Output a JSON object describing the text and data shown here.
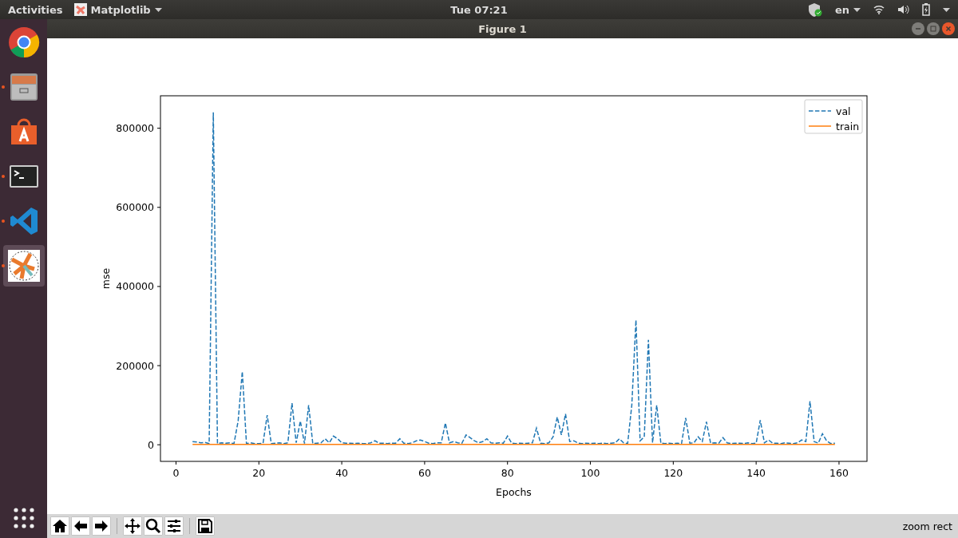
{
  "top_bar": {
    "activities": "Activities",
    "app_menu": "Matplotlib",
    "clock": "Tue 07:21",
    "language": "en"
  },
  "dock": {
    "items": [
      {
        "kind": "browser",
        "running": false,
        "selected": false
      },
      {
        "kind": "files",
        "running": true,
        "selected": false
      },
      {
        "kind": "software",
        "running": false,
        "selected": false
      },
      {
        "kind": "terminal",
        "running": true,
        "selected": false
      },
      {
        "kind": "editor",
        "running": true,
        "selected": false
      },
      {
        "kind": "matplotlib",
        "running": true,
        "selected": true
      }
    ]
  },
  "window": {
    "title": "Figure 1"
  },
  "figure": {
    "chart_data": {
      "type": "line",
      "xlabel": "Epochs",
      "ylabel": "mse",
      "x": [
        4,
        5,
        6,
        7,
        8,
        9,
        10,
        11,
        12,
        13,
        14,
        15,
        16,
        17,
        18,
        19,
        20,
        21,
        22,
        23,
        24,
        25,
        26,
        27,
        28,
        29,
        30,
        31,
        32,
        33,
        34,
        35,
        36,
        37,
        38,
        39,
        40,
        41,
        42,
        43,
        44,
        45,
        46,
        47,
        48,
        49,
        50,
        51,
        52,
        53,
        54,
        55,
        56,
        57,
        58,
        59,
        60,
        61,
        62,
        63,
        64,
        65,
        66,
        67,
        68,
        69,
        70,
        71,
        72,
        73,
        74,
        75,
        76,
        77,
        78,
        79,
        80,
        81,
        82,
        83,
        84,
        85,
        86,
        87,
        88,
        89,
        90,
        91,
        92,
        93,
        94,
        95,
        96,
        97,
        98,
        99,
        100,
        101,
        102,
        103,
        104,
        105,
        106,
        107,
        108,
        109,
        110,
        111,
        112,
        113,
        114,
        115,
        116,
        117,
        118,
        119,
        120,
        121,
        122,
        123,
        124,
        125,
        126,
        127,
        128,
        129,
        130,
        131,
        132,
        133,
        134,
        135,
        136,
        137,
        138,
        139,
        140,
        141,
        142,
        143,
        144,
        145,
        146,
        147,
        148,
        149,
        150,
        151,
        152,
        153,
        154,
        155,
        156,
        157,
        158,
        159
      ],
      "series": [
        {
          "name": "val",
          "color": "#1f77b4",
          "line_style": "dashed",
          "values": [
            8000,
            7000,
            5000,
            6000,
            3000,
            840000,
            3000,
            5000,
            4000,
            5000,
            3000,
            60000,
            185000,
            3000,
            5000,
            3000,
            3000,
            4000,
            75000,
            3000,
            4000,
            5000,
            3000,
            5000,
            105000,
            5000,
            60000,
            3000,
            100000,
            3000,
            4000,
            5000,
            15000,
            5000,
            22000,
            15000,
            5000,
            4000,
            4000,
            3000,
            4000,
            3000,
            3000,
            5000,
            10000,
            4000,
            4000,
            3000,
            4000,
            4000,
            15000,
            4000,
            3000,
            5000,
            10000,
            12000,
            8000,
            4000,
            3000,
            5000,
            5000,
            55000,
            5000,
            8000,
            5000,
            4000,
            25000,
            18000,
            10000,
            5000,
            8000,
            15000,
            5000,
            4000,
            5000,
            4000,
            22000,
            4000,
            3000,
            4000,
            3000,
            4000,
            5000,
            42000,
            4000,
            3000,
            5000,
            20000,
            70000,
            25000,
            78000,
            8000,
            10000,
            4000,
            3000,
            4000,
            3000,
            4000,
            3000,
            4000,
            3000,
            4000,
            5000,
            15000,
            5000,
            3000,
            100000,
            315000,
            10000,
            20000,
            265000,
            5000,
            100000,
            4000,
            3000,
            4000,
            3000,
            4000,
            3000,
            68000,
            4000,
            5000,
            20000,
            8000,
            58000,
            4000,
            5000,
            4000,
            18000,
            5000,
            3000,
            4000,
            4000,
            3000,
            5000,
            3000,
            4000,
            62000,
            5000,
            12000,
            4000,
            4000,
            3000,
            5000,
            4000,
            3000,
            5000,
            12000,
            8000,
            110000,
            8000,
            4000,
            28000,
            10000,
            3000,
            4000
          ]
        },
        {
          "name": "train",
          "color": "#ff7f0e",
          "line_style": "solid",
          "values": [
            1000,
            1000,
            1000,
            1000,
            1000,
            1000,
            1000,
            1000,
            1000,
            1000,
            1000,
            1000,
            1000,
            1000,
            1000,
            1000,
            1000,
            1000,
            1000,
            1000,
            1000,
            1000,
            1000,
            1000,
            1000,
            1000,
            1000,
            1000,
            1000,
            1000,
            1000,
            1000,
            1000,
            1000,
            1000,
            1000,
            1000,
            1000,
            1000,
            1000,
            1000,
            1000,
            1000,
            1000,
            1000,
            1000,
            1000,
            1000,
            1000,
            1000,
            1000,
            1000,
            1000,
            1000,
            1000,
            1000,
            1000,
            1000,
            1000,
            1000,
            1000,
            1000,
            1000,
            1000,
            1000,
            1000,
            1000,
            1000,
            1000,
            1000,
            1000,
            1000,
            1000,
            1000,
            1000,
            1000,
            1000,
            1000,
            1000,
            1000,
            1000,
            1000,
            1000,
            1000,
            1000,
            1000,
            1000,
            1000,
            1000,
            1000,
            1000,
            1000,
            1000,
            1000,
            1000,
            1000,
            1000,
            1000,
            1000,
            1000,
            1000,
            1000,
            1000,
            1000,
            1000,
            1000,
            1000,
            1000,
            1000,
            1000,
            1000,
            1000,
            1000,
            1000,
            1000,
            1000,
            1000,
            1000,
            1000,
            1000,
            1000,
            1000,
            1000,
            1000,
            1000,
            1000,
            1000,
            1000,
            1000,
            1000,
            1000,
            1000,
            1000,
            1000,
            1000,
            1000,
            1000,
            1000,
            1000,
            1000,
            1000,
            1000,
            1000,
            1000,
            1000,
            1000,
            1000,
            1000,
            1000,
            1000,
            1000,
            1000,
            1000,
            1000,
            1000,
            1000
          ]
        }
      ],
      "legend": true,
      "xlim": [
        -3.75,
        166.75
      ],
      "ylim": [
        -42000,
        882000
      ],
      "xticks": [
        0,
        20,
        40,
        60,
        80,
        100,
        120,
        140,
        160
      ],
      "yticks": [
        0,
        200000,
        400000,
        600000,
        800000
      ]
    }
  },
  "toolbar": {
    "buttons": [
      {
        "kind": "home"
      },
      {
        "kind": "back"
      },
      {
        "kind": "forward"
      },
      {
        "kind": "separator"
      },
      {
        "kind": "pan"
      },
      {
        "kind": "zoom"
      },
      {
        "kind": "configure"
      },
      {
        "kind": "separator"
      },
      {
        "kind": "save"
      }
    ],
    "message": "zoom rect"
  }
}
